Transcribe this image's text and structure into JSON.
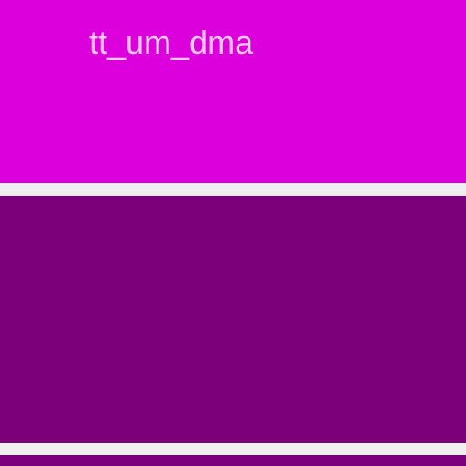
{
  "panels": {
    "top": {
      "label": "tt_um_dma",
      "color": "#dc00dc"
    },
    "bottom": {
      "color": "#7b0079"
    }
  }
}
